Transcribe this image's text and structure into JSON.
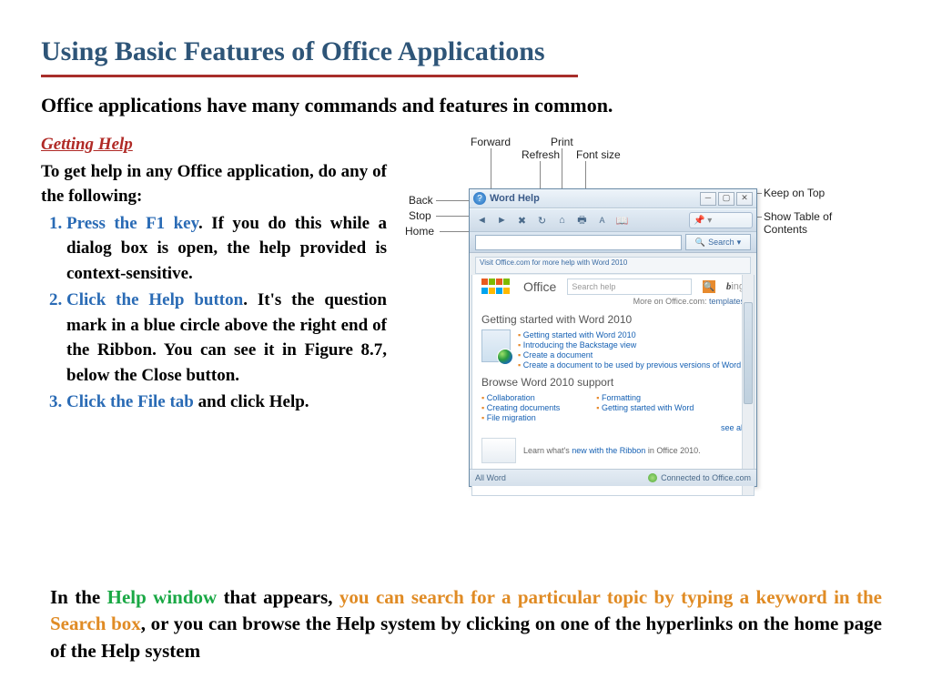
{
  "title": "Using Basic Features of Office Applications",
  "intro": "Office applications have many commands and features in common.",
  "section_heading": "Getting Help",
  "help_lead": "To get help in any Office application, do any of the following:",
  "steps": {
    "s1_key": "Press the F1 key",
    "s1_rest": ". If you do this while a dialog box is open, the help provided is context-sensitive.",
    "s2_key": "Click the Help button",
    "s2_rest": ". It's the question mark in a blue circle above the right end of the Ribbon. You can see it in Figure 8.7, below the Close button.",
    "s3_key": "Click the File tab",
    "s3_rest": " and click Help."
  },
  "callouts": {
    "forward": "Forward",
    "refresh": "Refresh",
    "print": "Print",
    "fontsize": "Font size",
    "back": "Back",
    "stop": "Stop",
    "home": "Home",
    "keepontop": "Keep on Top",
    "showtoc": "Show Table of Contents"
  },
  "helpwin": {
    "title": "Word Help",
    "search_dropdown": "Search",
    "crumb": "Visit Office.com for more help with Word 2010",
    "brand": "Office",
    "search_placeholder": "Search help",
    "bing_prefix": "b",
    "bing_rest": "ing",
    "more_label": "More on Office.com:",
    "more_link": "templates",
    "section1": "Getting started with Word 2010",
    "links1": {
      "a": "Getting started with Word 2010",
      "b": "Introducing the Backstage view",
      "c": "Create a document",
      "d": "Create a document to be used by previous versions of Word"
    },
    "section2": "Browse Word 2010 support",
    "links2": {
      "a": "Collaboration",
      "b": "Creating documents",
      "c": "File migration",
      "d": "Formatting",
      "e": "Getting started with Word"
    },
    "see_all": "see all",
    "ribbon_promo_a": "Learn what's ",
    "ribbon_promo_b": "new with the Ribbon",
    "ribbon_promo_c": " in Office 2010.",
    "status_left": "All Word",
    "status_right": "Connected to Office.com"
  },
  "bottom": {
    "t1": "In the ",
    "t2": "Help window",
    "t3": " that appears, ",
    "t4": "you can search for a particular topic by typing a keyword in the Search box",
    "t5": ", or you can browse the Help system by clicking on one of the hyperlinks on the home page of the Help system"
  }
}
